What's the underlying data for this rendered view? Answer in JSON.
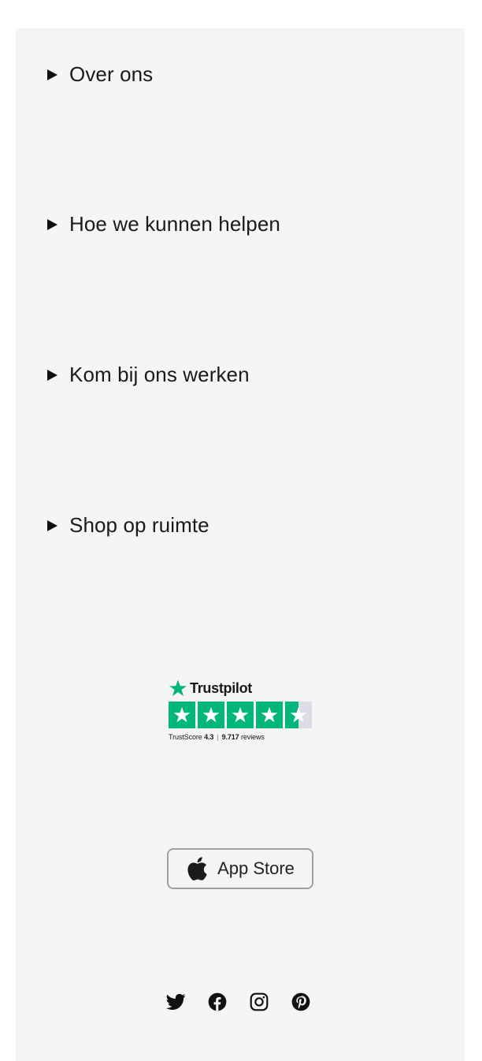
{
  "footer": {
    "accordion": [
      {
        "label": "Over ons"
      },
      {
        "label": "Hoe we kunnen helpen"
      },
      {
        "label": "Kom bij ons werken"
      },
      {
        "label": "Shop op ruimte"
      }
    ],
    "trustpilot": {
      "brand": "Trustpilot",
      "score_label": "TrustScore",
      "score_value": "4.3",
      "reviews_count": "9.717",
      "reviews_label": "reviews",
      "stars": 4.5,
      "star_color": "#00b67a"
    },
    "appstore": {
      "label": "App Store",
      "icon": "apple-icon"
    },
    "social": [
      {
        "icon": "twitter-icon"
      },
      {
        "icon": "facebook-icon"
      },
      {
        "icon": "instagram-icon"
      },
      {
        "icon": "pinterest-icon"
      }
    ]
  }
}
